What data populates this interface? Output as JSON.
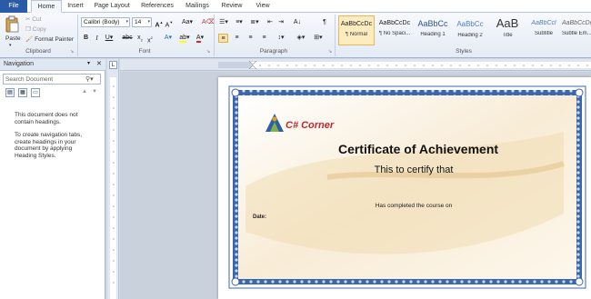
{
  "tabs": [
    "File",
    "Home",
    "Insert",
    "Page Layout",
    "References",
    "Mailings",
    "Review",
    "View"
  ],
  "clipboard": {
    "paste": "Paste",
    "cut": "Cut",
    "copy": "Copy",
    "format_painter": "Format Painter",
    "label": "Clipboard"
  },
  "font": {
    "name": "Calibri (Body)",
    "size": "14",
    "label": "Font"
  },
  "paragraph": {
    "label": "Paragraph"
  },
  "styles": {
    "label": "Styles",
    "items": [
      {
        "preview": "AaBbCcDc",
        "name": "¶ Normal"
      },
      {
        "preview": "AaBbCcDc",
        "name": "¶ No Spaci..."
      },
      {
        "preview": "AaBbCc",
        "name": "Heading 1"
      },
      {
        "preview": "AaBbCc",
        "name": "Heading 2"
      },
      {
        "preview": "AaB",
        "name": "Title"
      },
      {
        "preview": "AaBbCcl",
        "name": "Subtitle"
      },
      {
        "preview": "AaBbCcDc",
        "name": "Subtle Em..."
      }
    ]
  },
  "navigation": {
    "title": "Navigation",
    "search_placeholder": "Search Document",
    "msg1": "This document does not contain headings.",
    "msg2": "To create navigation tabs, create headings in your document by applying Heading Styles."
  },
  "certificate": {
    "logo_text": "C# Corner",
    "title": "Certificate of Achievement",
    "subtitle": "This to certify that",
    "completed": "Has completed the course on",
    "date_label": "Date:"
  },
  "colors": {
    "accent": "#2a5aa8",
    "border": "#3a66b0",
    "logo_red": "#c0282d"
  }
}
